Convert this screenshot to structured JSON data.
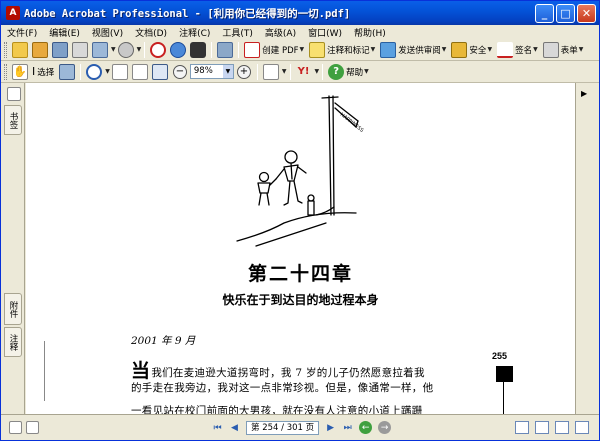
{
  "window": {
    "title": "Adobe Acrobat Professional - [利用你已经得到的一切.pdf]",
    "app_icon_label": "A",
    "buttons": {
      "minimize": "_",
      "maximize": "□",
      "close": "✕"
    }
  },
  "menubar": {
    "items": [
      {
        "label": "文件(F)"
      },
      {
        "label": "编辑(E)"
      },
      {
        "label": "视图(V)"
      },
      {
        "label": "文档(D)"
      },
      {
        "label": "注释(C)"
      },
      {
        "label": "工具(T)"
      },
      {
        "label": "高级(A)"
      },
      {
        "label": "窗口(W)"
      },
      {
        "label": "帮助(H)"
      }
    ]
  },
  "toolbar1": {
    "create_pdf": "创建 PDF",
    "comment_markup": "注释和标记",
    "send_review": "发送供审阅",
    "security": "安全",
    "sign": "签名",
    "forms": "表单"
  },
  "toolbar2": {
    "select": "选择",
    "zoom": "98%",
    "help": "帮助"
  },
  "leftnav": {
    "tab_bookmarks": "书签",
    "tab_attachments": "附件",
    "tab_comments": "注释"
  },
  "document": {
    "chapter_title": "第二十四章",
    "chapter_subtitle": "快乐在于到达目的地过程本身",
    "date": "2001 年 9 月",
    "page_number": "255",
    "dropcap": "当",
    "line1": "我们在麦迪逊大道拐弯时，我 7 岁的儿子仍然愿意拉着我",
    "line2": "的手走在我旁边，我对这一点非常珍视。但是，像通常一样，他",
    "line3": "一看见站在校门前面的大男孩，就在没有人注意的小道上蹒跚"
  },
  "statusbar": {
    "page_display": "第 254 / 301 页"
  },
  "colors": {
    "titlebar": "#0453D8",
    "chrome": "#ECE9D8",
    "close_button": "#C8381C"
  }
}
